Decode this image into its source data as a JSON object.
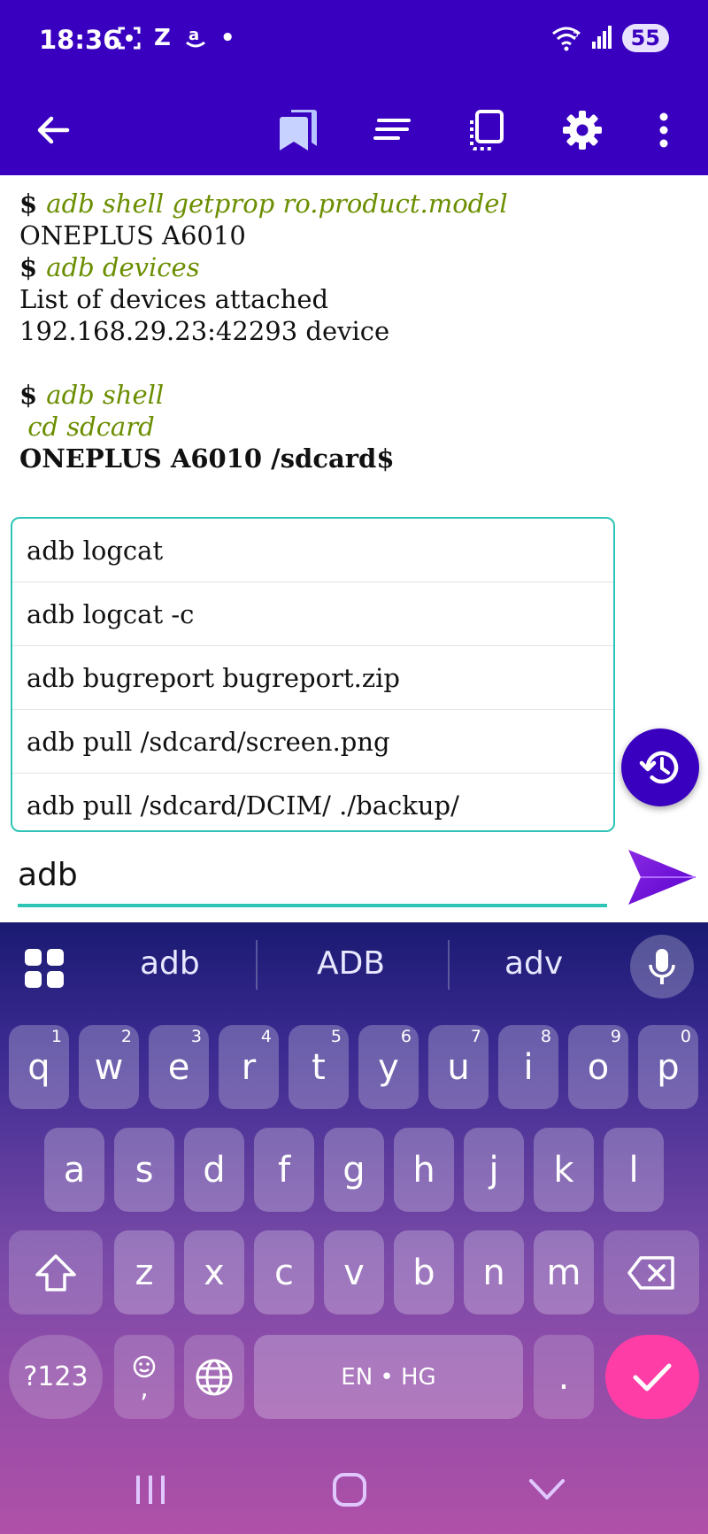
{
  "status_bar": {
    "time": "18:36",
    "notif_z": "Z",
    "notif_dot": "•",
    "battery": "55",
    "signal_label": "5"
  },
  "toolbar": {
    "icons": [
      "arrow-back-icon",
      "bookmarks-icon",
      "short-text-icon",
      "devices-icon",
      "gear-icon",
      "more-vert-icon"
    ]
  },
  "terminal": {
    "lines": [
      {
        "prompt": "$ ",
        "cmd": "adb shell getprop ro.product.model"
      },
      {
        "text": "ONEPLUS A6010"
      },
      {
        "prompt": "$ ",
        "cmd": "adb devices"
      },
      {
        "text": "List of devices attached"
      },
      {
        "text": "192.168.29.23:42293 device"
      },
      {
        "text": ""
      },
      {
        "prompt": "$ ",
        "cmd": "adb shell"
      },
      {
        "cmd": " cd sdcard"
      },
      {
        "bold": "ONEPLUS A6010 /sdcard$"
      }
    ]
  },
  "suggestions": [
    "adb logcat",
    "adb logcat -c",
    "adb bugreport bugreport.zip",
    "adb pull /sdcard/screen.png",
    "adb pull /sdcard/DCIM/ ./backup/"
  ],
  "input": {
    "value": "adb"
  },
  "keyboard": {
    "strip": [
      "adb",
      "ADB",
      "adv"
    ],
    "row1": [
      {
        "k": "q",
        "h": "1"
      },
      {
        "k": "w",
        "h": "2"
      },
      {
        "k": "e",
        "h": "3"
      },
      {
        "k": "r",
        "h": "4"
      },
      {
        "k": "t",
        "h": "5"
      },
      {
        "k": "y",
        "h": "6"
      },
      {
        "k": "u",
        "h": "7"
      },
      {
        "k": "i",
        "h": "8"
      },
      {
        "k": "o",
        "h": "9"
      },
      {
        "k": "p",
        "h": "0"
      }
    ],
    "row2": [
      "a",
      "s",
      "d",
      "f",
      "g",
      "h",
      "j",
      "k",
      "l"
    ],
    "row3": [
      "z",
      "x",
      "c",
      "v",
      "b",
      "n",
      "m"
    ],
    "symbols_key": "?123",
    "emoji_comma": ",",
    "space_label": "EN • HG",
    "period_key": ".",
    "colors": {
      "enter": "#ff3da6",
      "accent": "#3a00c0",
      "teal": "#2ec4b6"
    }
  }
}
